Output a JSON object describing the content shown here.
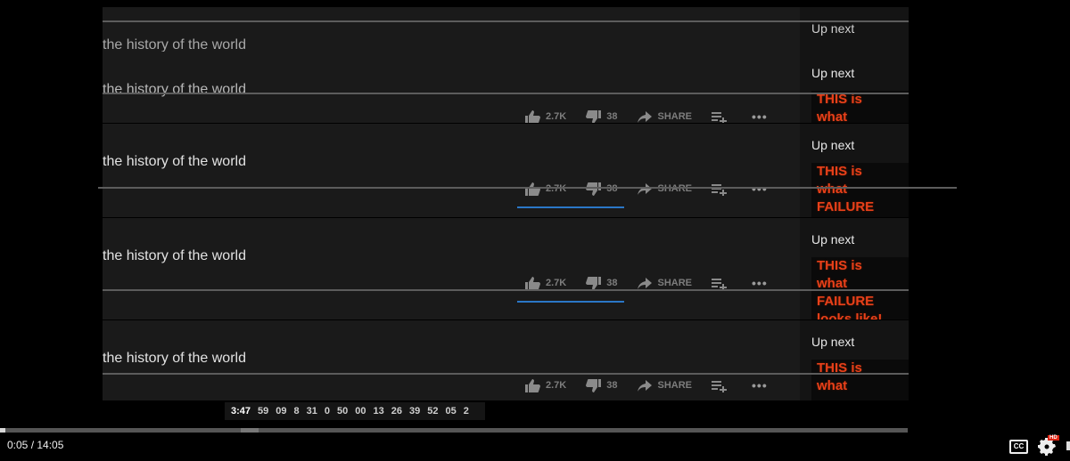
{
  "video": {
    "title": "the history of the world"
  },
  "actions": {
    "likes": "2.7K",
    "dislikes": "38",
    "share": "SHARE"
  },
  "sidebar": {
    "up_next": "Up next",
    "thumb_lines": [
      "THIS is",
      "what",
      "FAILURE",
      "looks like!"
    ]
  },
  "storyboard": {
    "current": "3:47",
    "ticks": [
      "59",
      "09",
      "8",
      "31",
      "0",
      "50",
      "00",
      "13",
      "26",
      "39",
      "52",
      "05",
      "2"
    ]
  },
  "player": {
    "time": "0:05 / 14:05",
    "progress_fraction": 0.006,
    "cc_label": "CC",
    "hd_label": "HD",
    "colors": {
      "bg": "#000000",
      "panel": "#1a1a1a",
      "accent": "#2a77c7",
      "thumb_text": "#e8401a"
    }
  }
}
